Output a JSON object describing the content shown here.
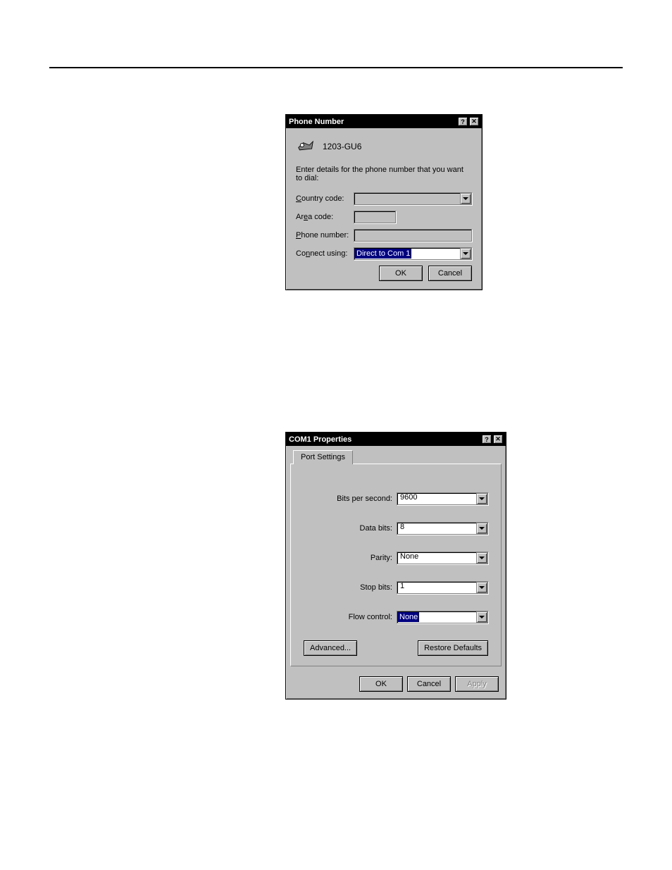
{
  "phone_dialog": {
    "title": "Phone Number",
    "connection_name": "1203-GU6",
    "instruction": "Enter details for the phone number that you want to dial:",
    "labels": {
      "country_code": "Country code:",
      "area_code": "Area code:",
      "phone_number": "Phone number:",
      "connect_using": "Connect using:"
    },
    "values": {
      "country_code": "",
      "area_code": "",
      "phone_number": "",
      "connect_using": "Direct to Com 1"
    },
    "buttons": {
      "ok": "OK",
      "cancel": "Cancel"
    }
  },
  "com_dialog": {
    "title": "COM1 Properties",
    "tab": "Port Settings",
    "labels": {
      "bits_per_second": "Bits per second:",
      "data_bits": "Data bits:",
      "parity": "Parity:",
      "stop_bits": "Stop bits:",
      "flow_control": "Flow control:"
    },
    "values": {
      "bits_per_second": "9600",
      "data_bits": "8",
      "parity": "None",
      "stop_bits": "1",
      "flow_control": "None"
    },
    "buttons": {
      "advanced": "Advanced...",
      "restore": "Restore Defaults",
      "ok": "OK",
      "cancel": "Cancel",
      "apply": "Apply"
    }
  }
}
